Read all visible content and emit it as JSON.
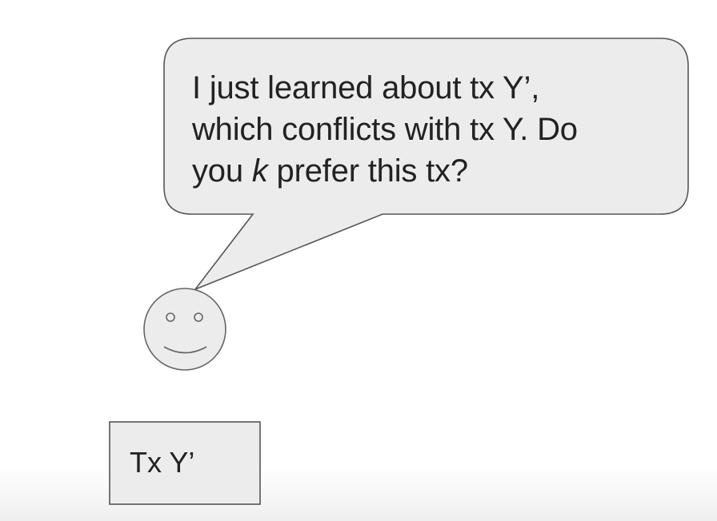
{
  "bubble": {
    "line1": "I just learned about tx Y’,",
    "line2": "which conflicts with tx Y. Do",
    "line3_pre": "you ",
    "line3_k": "k",
    "line3_post": " prefer this tx?"
  },
  "tx_box": {
    "label": "Tx Y’"
  },
  "colors": {
    "fill": "#ececec",
    "stroke": "#555555",
    "text": "#222222"
  }
}
